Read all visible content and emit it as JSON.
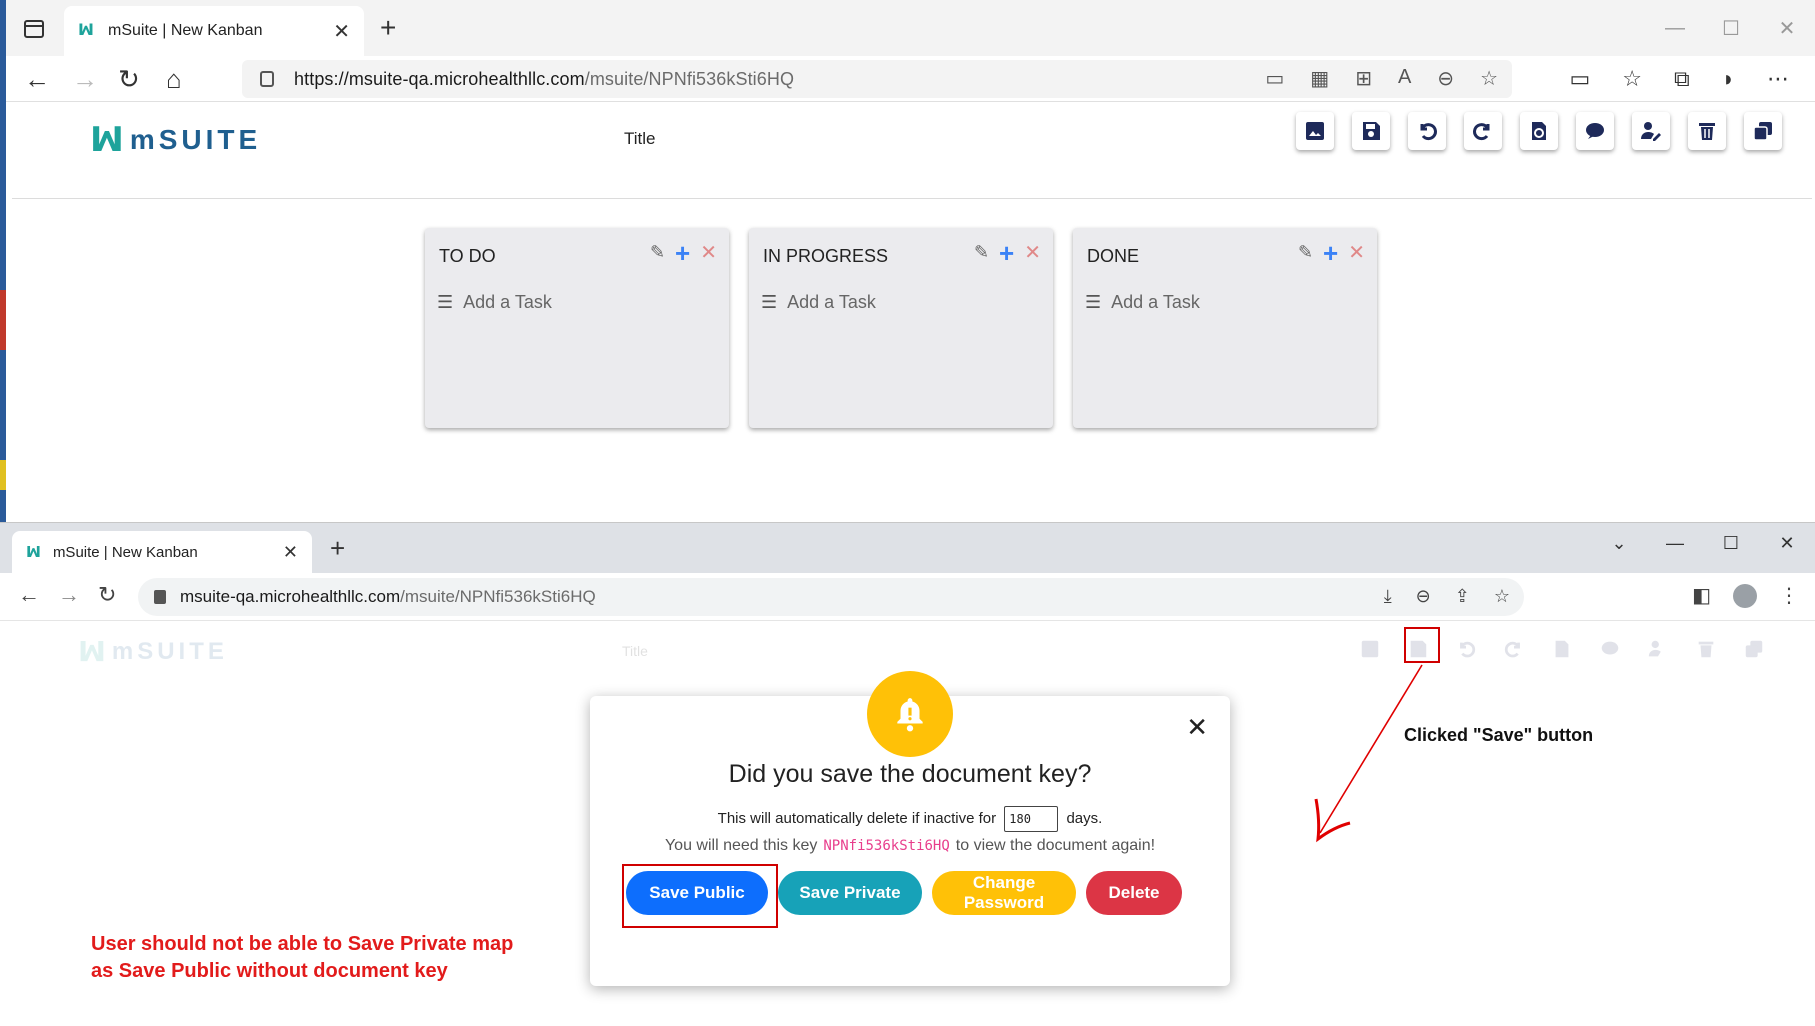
{
  "window1": {
    "tab_title": "mSuite | New Kanban",
    "url_host": "https://msuite-qa.microhealthllc.com",
    "url_path": "/msuite/NPNfi536kSti6HQ"
  },
  "window2": {
    "tab_title": "mSuite | New Kanban",
    "url_host": "msuite-qa.microhealthllc.com",
    "url_path": "/msuite/NPNfi536kSti6HQ"
  },
  "app": {
    "logo_text": "mSUITE",
    "doc_title": "Title",
    "brand_color": "#1ea39b",
    "logo_text_color": "#1f5f8f"
  },
  "toolbar_icons": [
    "image-icon",
    "save-icon",
    "undo-icon",
    "redo-icon",
    "restore-icon",
    "comment-icon",
    "user-edit-icon",
    "trash-icon",
    "copy-icon"
  ],
  "kanban": {
    "columns": [
      {
        "title": "TO DO",
        "add_label": "Add a Task"
      },
      {
        "title": "IN PROGRESS",
        "add_label": "Add a Task"
      },
      {
        "title": "DONE",
        "add_label": "Add a Task"
      }
    ]
  },
  "modal": {
    "title": "Did you save the document key?",
    "line1_prefix": "This will automatically delete if inactive for",
    "days_value": "180",
    "line1_suffix": "days.",
    "line2_prefix": "You will need this key",
    "doc_key": "NPNfi536kSti6HQ",
    "line2_suffix": "to view the document again!",
    "buttons": {
      "save_public": "Save Public",
      "save_private": "Save Private",
      "change_password": "Change Password",
      "delete": "Delete"
    },
    "bell_color": "#ffc107"
  },
  "annotations": {
    "left_note_line1": "User should not be able to Save Private map",
    "left_note_line2": "as Save Public without document key",
    "right_note": "Clicked \"Save\" button",
    "highlight_color": "#d00000"
  }
}
